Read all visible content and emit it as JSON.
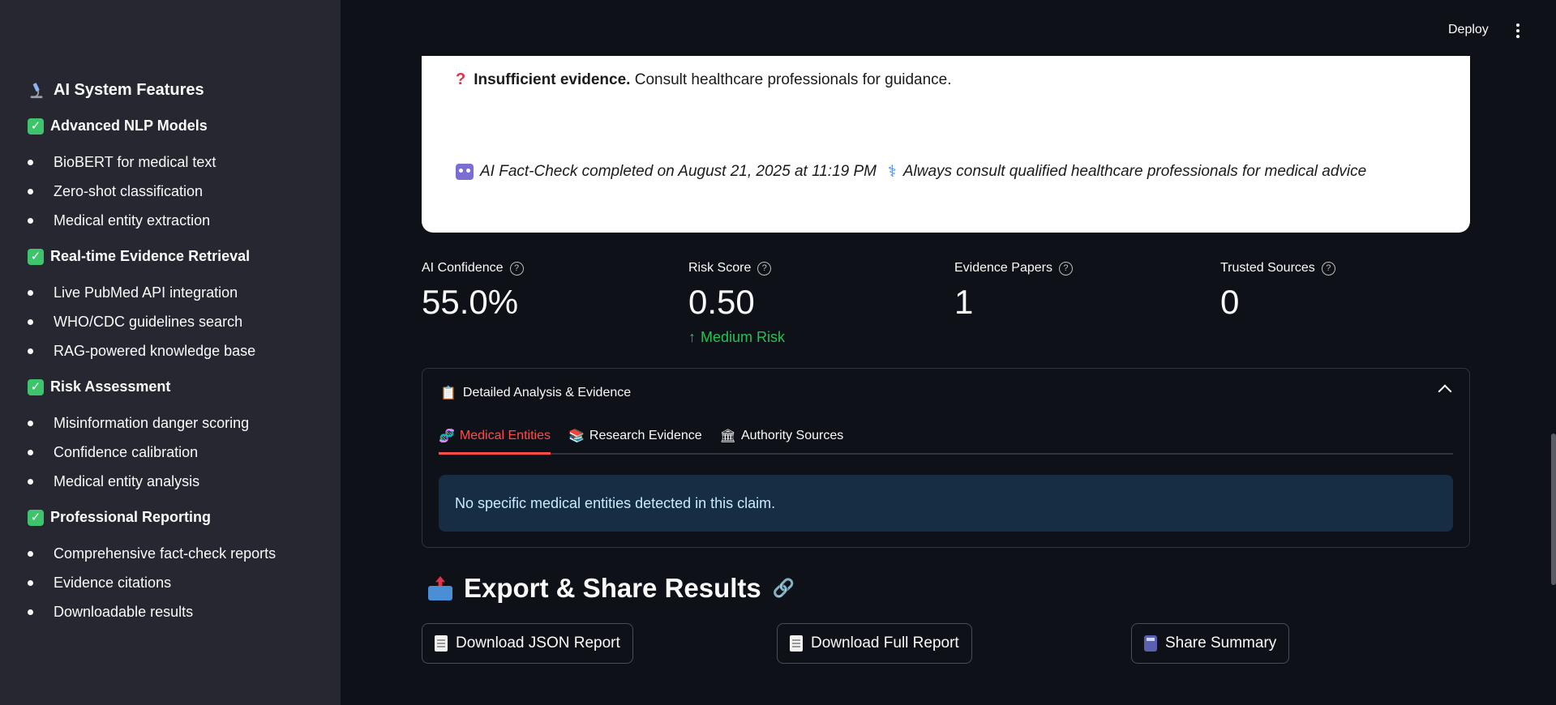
{
  "sidebar": {
    "title": "AI System Features",
    "sections": [
      {
        "heading": "Advanced NLP Models",
        "items": [
          "BioBERT for medical text",
          "Zero-shot classification",
          "Medical entity extraction"
        ]
      },
      {
        "heading": "Real-time Evidence Retrieval",
        "items": [
          "Live PubMed API integration",
          "WHO/CDC guidelines search",
          "RAG-powered knowledge base"
        ]
      },
      {
        "heading": "Risk Assessment",
        "items": [
          "Misinformation danger scoring",
          "Confidence calibration",
          "Medical entity analysis"
        ]
      },
      {
        "heading": "Professional Reporting",
        "items": [
          "Comprehensive fact-check reports",
          "Evidence citations",
          "Downloadable results"
        ]
      }
    ]
  },
  "topbar": {
    "deploy_label": "Deploy"
  },
  "result_card": {
    "verdict_bold": "Insufficient evidence.",
    "verdict_text": "Consult healthcare professionals for guidance.",
    "footer_completed": "AI Fact-Check completed on August 21, 2025 at 11:19 PM",
    "footer_disclaimer": "Always consult qualified healthcare professionals for medical advice"
  },
  "metrics": [
    {
      "label": "AI Confidence",
      "value": "55.0%"
    },
    {
      "label": "Risk Score",
      "value": "0.50",
      "delta": "Medium Risk"
    },
    {
      "label": "Evidence Papers",
      "value": "1"
    },
    {
      "label": "Trusted Sources",
      "value": "0"
    }
  ],
  "expander": {
    "title": "Detailed Analysis & Evidence",
    "tabs": [
      "Medical Entities",
      "Research Evidence",
      "Authority Sources"
    ],
    "active_tab": "Medical Entities",
    "info_message": "No specific medical entities detected in this claim."
  },
  "export": {
    "title": "Export & Share Results",
    "buttons": [
      "Download JSON Report",
      "Download Full Report",
      "Share Summary"
    ]
  },
  "colors": {
    "accent": "#ff4b4b",
    "success": "#21c354",
    "info_bg": "#172d43",
    "background": "#0e1117",
    "sidebar_bg": "#262730"
  },
  "icons": [
    "microscope-icon",
    "check-icon",
    "question-icon",
    "robot-icon",
    "caduceus-icon",
    "help-icon",
    "arrow-up-icon",
    "clipboard-icon",
    "dna-icon",
    "books-icon",
    "bank-icon",
    "inbox-icon",
    "link-icon",
    "document-icon",
    "calculator-icon"
  ]
}
